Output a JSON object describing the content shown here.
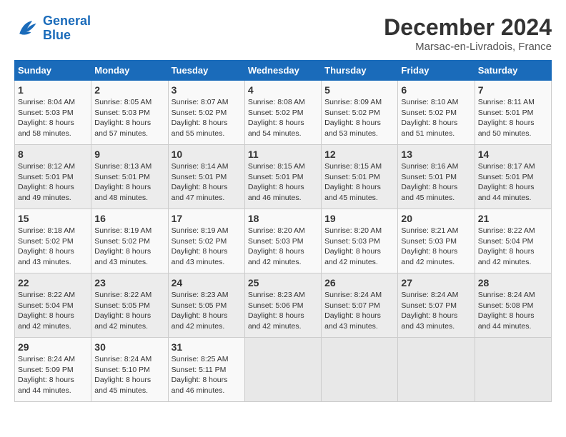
{
  "logo": {
    "line1": "General",
    "line2": "Blue"
  },
  "title": "December 2024",
  "subtitle": "Marsac-en-Livradois, France",
  "days_header": [
    "Sunday",
    "Monday",
    "Tuesday",
    "Wednesday",
    "Thursday",
    "Friday",
    "Saturday"
  ],
  "weeks": [
    [
      {
        "day": 1,
        "sunrise": "8:04 AM",
        "sunset": "5:03 PM",
        "daylight": "8 hours and 58 minutes."
      },
      {
        "day": 2,
        "sunrise": "8:05 AM",
        "sunset": "5:03 PM",
        "daylight": "8 hours and 57 minutes."
      },
      {
        "day": 3,
        "sunrise": "8:07 AM",
        "sunset": "5:02 PM",
        "daylight": "8 hours and 55 minutes."
      },
      {
        "day": 4,
        "sunrise": "8:08 AM",
        "sunset": "5:02 PM",
        "daylight": "8 hours and 54 minutes."
      },
      {
        "day": 5,
        "sunrise": "8:09 AM",
        "sunset": "5:02 PM",
        "daylight": "8 hours and 53 minutes."
      },
      {
        "day": 6,
        "sunrise": "8:10 AM",
        "sunset": "5:02 PM",
        "daylight": "8 hours and 51 minutes."
      },
      {
        "day": 7,
        "sunrise": "8:11 AM",
        "sunset": "5:01 PM",
        "daylight": "8 hours and 50 minutes."
      }
    ],
    [
      {
        "day": 8,
        "sunrise": "8:12 AM",
        "sunset": "5:01 PM",
        "daylight": "8 hours and 49 minutes."
      },
      {
        "day": 9,
        "sunrise": "8:13 AM",
        "sunset": "5:01 PM",
        "daylight": "8 hours and 48 minutes."
      },
      {
        "day": 10,
        "sunrise": "8:14 AM",
        "sunset": "5:01 PM",
        "daylight": "8 hours and 47 minutes."
      },
      {
        "day": 11,
        "sunrise": "8:15 AM",
        "sunset": "5:01 PM",
        "daylight": "8 hours and 46 minutes."
      },
      {
        "day": 12,
        "sunrise": "8:15 AM",
        "sunset": "5:01 PM",
        "daylight": "8 hours and 45 minutes."
      },
      {
        "day": 13,
        "sunrise": "8:16 AM",
        "sunset": "5:01 PM",
        "daylight": "8 hours and 45 minutes."
      },
      {
        "day": 14,
        "sunrise": "8:17 AM",
        "sunset": "5:01 PM",
        "daylight": "8 hours and 44 minutes."
      }
    ],
    [
      {
        "day": 15,
        "sunrise": "8:18 AM",
        "sunset": "5:02 PM",
        "daylight": "8 hours and 43 minutes."
      },
      {
        "day": 16,
        "sunrise": "8:19 AM",
        "sunset": "5:02 PM",
        "daylight": "8 hours and 43 minutes."
      },
      {
        "day": 17,
        "sunrise": "8:19 AM",
        "sunset": "5:02 PM",
        "daylight": "8 hours and 43 minutes."
      },
      {
        "day": 18,
        "sunrise": "8:20 AM",
        "sunset": "5:03 PM",
        "daylight": "8 hours and 42 minutes."
      },
      {
        "day": 19,
        "sunrise": "8:20 AM",
        "sunset": "5:03 PM",
        "daylight": "8 hours and 42 minutes."
      },
      {
        "day": 20,
        "sunrise": "8:21 AM",
        "sunset": "5:03 PM",
        "daylight": "8 hours and 42 minutes."
      },
      {
        "day": 21,
        "sunrise": "8:22 AM",
        "sunset": "5:04 PM",
        "daylight": "8 hours and 42 minutes."
      }
    ],
    [
      {
        "day": 22,
        "sunrise": "8:22 AM",
        "sunset": "5:04 PM",
        "daylight": "8 hours and 42 minutes."
      },
      {
        "day": 23,
        "sunrise": "8:22 AM",
        "sunset": "5:05 PM",
        "daylight": "8 hours and 42 minutes."
      },
      {
        "day": 24,
        "sunrise": "8:23 AM",
        "sunset": "5:05 PM",
        "daylight": "8 hours and 42 minutes."
      },
      {
        "day": 25,
        "sunrise": "8:23 AM",
        "sunset": "5:06 PM",
        "daylight": "8 hours and 42 minutes."
      },
      {
        "day": 26,
        "sunrise": "8:24 AM",
        "sunset": "5:07 PM",
        "daylight": "8 hours and 43 minutes."
      },
      {
        "day": 27,
        "sunrise": "8:24 AM",
        "sunset": "5:07 PM",
        "daylight": "8 hours and 43 minutes."
      },
      {
        "day": 28,
        "sunrise": "8:24 AM",
        "sunset": "5:08 PM",
        "daylight": "8 hours and 44 minutes."
      }
    ],
    [
      {
        "day": 29,
        "sunrise": "8:24 AM",
        "sunset": "5:09 PM",
        "daylight": "8 hours and 44 minutes."
      },
      {
        "day": 30,
        "sunrise": "8:24 AM",
        "sunset": "5:10 PM",
        "daylight": "8 hours and 45 minutes."
      },
      {
        "day": 31,
        "sunrise": "8:25 AM",
        "sunset": "5:11 PM",
        "daylight": "8 hours and 46 minutes."
      },
      null,
      null,
      null,
      null
    ]
  ]
}
